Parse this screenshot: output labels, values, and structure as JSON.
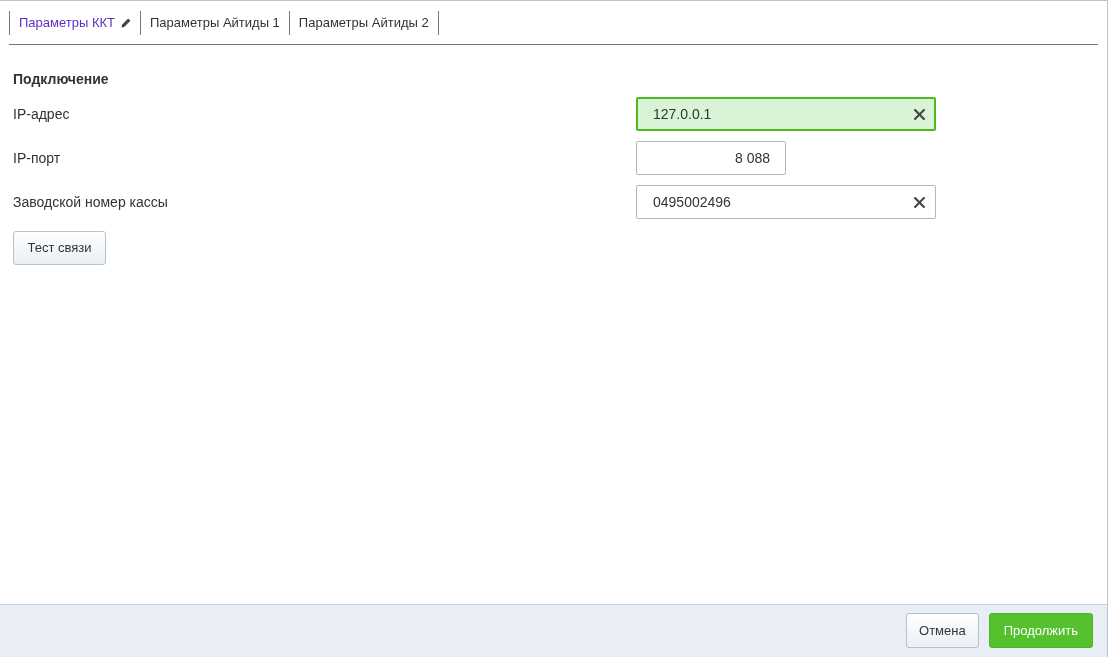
{
  "tabs": [
    {
      "label": "Параметры ККТ",
      "selected": true,
      "edited": true
    },
    {
      "label": "Параметры Айтиды 1",
      "selected": false,
      "edited": false
    },
    {
      "label": "Параметры Айтиды 2",
      "selected": false,
      "edited": false
    }
  ],
  "section": {
    "title": "Подключение",
    "fields": [
      {
        "label": "IP-адрес",
        "kind": "text",
        "value": "127.0.0.1",
        "valid": true
      },
      {
        "label": "IP-порт",
        "kind": "number",
        "value": "8 088",
        "valid": false
      },
      {
        "label": "Заводской номер кассы",
        "kind": "text",
        "value": "0495002496",
        "valid": false
      }
    ],
    "button": "Тест связи"
  },
  "footer": {
    "buttons": [
      {
        "label": "Отмена",
        "kind": "secondary"
      },
      {
        "label": "Продолжить",
        "kind": "primary"
      }
    ]
  }
}
